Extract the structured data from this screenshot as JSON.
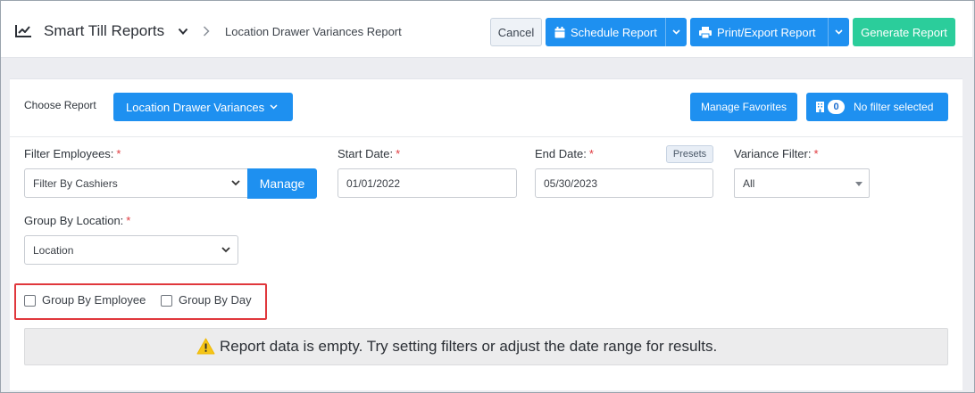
{
  "header": {
    "app_title": "Smart Till Reports",
    "breadcrumb_current": "Location Drawer Variances Report",
    "cancel_label": "Cancel",
    "schedule_label": "Schedule Report",
    "print_label": "Print/Export Report",
    "generate_label": "Generate Report",
    "icons": [
      "chart-line-icon",
      "chevron-down-icon",
      "chevron-right-icon",
      "calendar-icon",
      "printer-icon"
    ]
  },
  "report_bar": {
    "choose_label": "Choose Report",
    "selected_report": "Location Drawer Variances",
    "favorites_label": "Manage Favorites",
    "filter_count": "0",
    "filter_label": "No filter selected"
  },
  "filters": {
    "employees": {
      "label": "Filter Employees:",
      "required": "*",
      "value": "Filter By Cashiers",
      "manage_label": "Manage"
    },
    "start_date": {
      "label": "Start Date:",
      "required": "*",
      "value": "01/01/2022"
    },
    "end_date": {
      "label": "End Date:",
      "required": "*",
      "value": "05/30/2023",
      "presets_label": "Presets"
    },
    "variance": {
      "label": "Variance Filter:",
      "required": "*",
      "value": "All"
    },
    "group_location": {
      "label": "Group By Location:",
      "required": "*",
      "value": "Location"
    }
  },
  "options": {
    "group_employee_label": "Group By Employee",
    "group_employee_checked": false,
    "group_day_label": "Group By Day",
    "group_day_checked": false
  },
  "empty_state": {
    "message": "Report data is empty. Try setting filters or adjust the date range for results."
  },
  "colors": {
    "primary": "#1e90f0",
    "success": "#2bcd9b",
    "required": "#e0393e",
    "highlight": "#e0373c",
    "warning": "#f5c518"
  }
}
